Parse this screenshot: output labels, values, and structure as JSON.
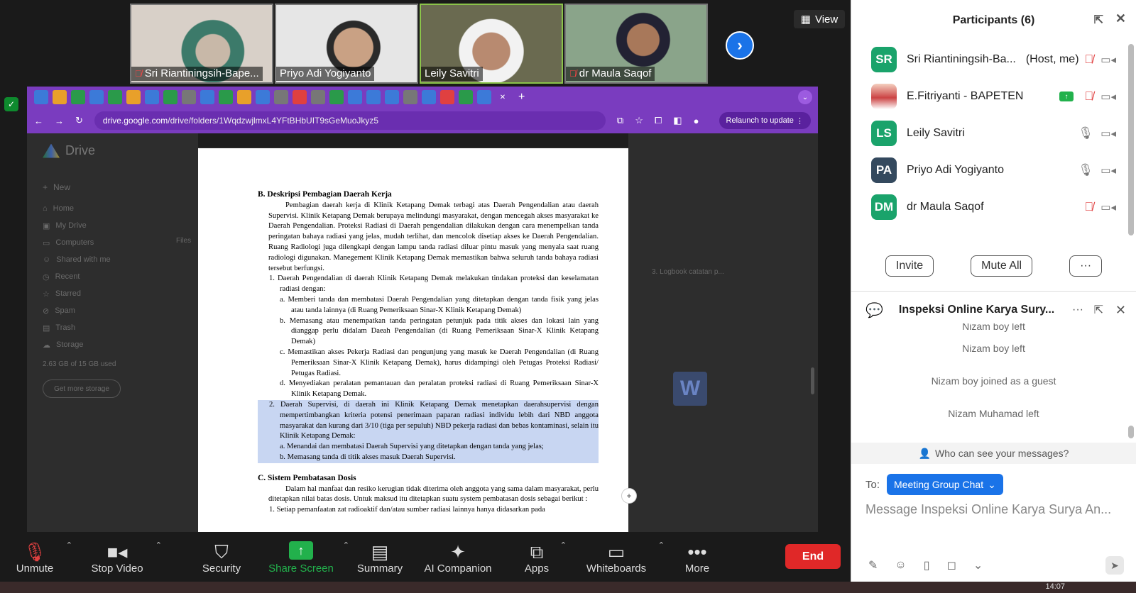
{
  "video_tiles": [
    {
      "name": "Sri Riantiningsih-Bape...",
      "muted": true
    },
    {
      "name": "Priyo Adi Yogiyanto",
      "muted": false
    },
    {
      "name": "Leily Savitri",
      "muted": false
    },
    {
      "name": "dr Maula Saqof",
      "muted": true
    }
  ],
  "view_label": "View",
  "browser": {
    "url_host": "drive.google.com",
    "url_path": "/drive/folders/1WqdzwjlmxL4YFtBHbUIT9sGeMuoJkyz5",
    "relaunch_label": "Relaunch to update"
  },
  "drive": {
    "logo_label": "Drive",
    "sidebar": [
      "Home",
      "My Drive",
      "Computers",
      "Shared with me",
      "Recent",
      "Starred",
      "Spam",
      "Trash",
      "Storage"
    ],
    "new_label": "New",
    "storage_text": "2.63 GB of 15 GB used",
    "get_more_label": "Get more storage",
    "doc_row": "3. Logbook catatan p...",
    "files_label": "Files"
  },
  "doc": {
    "heading_b": "B.  Deskripsi Pembagian Daerah Kerja",
    "para_b": "Pembagian daerah kerja di Klinik Ketapang Demak terbagi atas Daerah Pengendalian atau daerah Supervisi. Klinik Ketapang Demak berupaya melindungi masyarakat, dengan mencegah akses masyarakat ke Daerah Pengendalian. Proteksi Radiasi di Daerah pengendalian dilakukan dengan cara menempelkan tanda peringatan bahaya radiasi yang jelas, mudah terlihat, dan mencolok disetiap akses ke Daerah Pengendalian. Ruang Radiologi juga dilengkapi dengan lampu tanda radiasi diluar pintu masuk yang menyala saat ruang radiologi digunakan. Manegement Klinik Ketapang Demak memastikan bahwa seluruh tanda bahaya radiasi tersebut berfungsi.",
    "item1": "1.   Daerah Pengendalian di daerah Klinik Ketapang Demak melakukan tindakan proteksi dan keselamatan radiasi dengan:",
    "item1a": "a.   Memberi tanda dan membatasi Daerah Pengendalian yang ditetapkan dengan tanda fisik yang jelas atau tanda lainnya (di Ruang Pemeriksaan Sinar-X Klinik Ketapang Demak)",
    "item1b": "b.   Memasang atau menempatkan tanda peringatan petunjuk pada titik akses dan lokasi lain yang dianggap perlu didalam Daeah Pengendalian (di Ruang Pemeriksaan Sinar-X Klinik Ketapang Demak)",
    "item1c": "c.   Memastikan akses Pekerja Radiasi dan pengunjung yang masuk ke Daerah Pengendalian (di Ruang Pemeriksaan Sinar-X Klinik Ketapang Demak), harus didampingi oleh Petugas Proteksi Radiasi/ Petugas Radiasi.",
    "item1d": "d.   Menyediakan peralatan pemantauan dan peralatan proteksi radiasi di Ruang Pemeriksaan Sinar-X Klinik Ketapang Demak.",
    "item2": "2.   Daerah Supervisi, di daerah ini Klinik Ketapang Demak menetapkan daerahsupervisi dengan mempertimbangkan kriteria potensi penerimaan paparan radiasi individu lebih dari NBD anggota masyarakat dan kurang dari 3/10 (tiga per sepuluh) NBD pekerja radiasi dan bebas kontaminasi, selain itu Klinik Ketapang Demak:",
    "item2a": "a.   Menandai dan membatasi Daerah Supervisi yang ditetapkan dengan tanda yang jelas;",
    "item2b": "b.   Memasang tanda di titik akses masuk Daerah Supervisi.",
    "heading_c": "C. Sistem Pembatasan Dosis",
    "para_c": "Dalam hal manfaat dan resiko kerugian tidak diterima oleh anggota yang sama dalam masyarakat, perlu ditetapkan nilai batas dosis. Untuk maksud itu ditetapkan suatu system pembatasan dosis sebagai berikut :",
    "item_c1": "1.   Setiap pemanfaatan zat radioaktif dan/atau sumber radiasi lainnya hanya didasarkan pada"
  },
  "controls": [
    {
      "label": "Unmute",
      "icon": "mic-muted-icon",
      "caret": true
    },
    {
      "label": "Stop Video",
      "icon": "video-icon",
      "caret": true
    },
    {
      "label": "Security",
      "icon": "shield-icon",
      "caret": false
    },
    {
      "label": "Share Screen",
      "icon": "share-screen-icon",
      "caret": true
    },
    {
      "label": "Summary",
      "icon": "summary-icon",
      "caret": false
    },
    {
      "label": "AI Companion",
      "icon": "sparkle-icon",
      "caret": false
    },
    {
      "label": "Apps",
      "icon": "apps-icon",
      "caret": true
    },
    {
      "label": "Whiteboards",
      "icon": "whiteboard-icon",
      "caret": true
    },
    {
      "label": "More",
      "icon": "more-icon",
      "caret": false
    }
  ],
  "end_label": "End",
  "clock": "14:07",
  "participants_panel": {
    "title": "Participants (6)",
    "list": [
      {
        "initials": "SR",
        "name": "Sri Riantiningsih-Ba...",
        "role": "(Host, me)",
        "color": "#1aa36b",
        "mic": "muted"
      },
      {
        "initials": "",
        "name": "E.Fitriyanti - BAPETEN",
        "role": "",
        "color": "#c44",
        "mic": "muted",
        "sharing": true
      },
      {
        "initials": "LS",
        "name": "Leily Savitri",
        "role": "",
        "color": "#1aa36b",
        "mic": "on"
      },
      {
        "initials": "PA",
        "name": "Priyo Adi Yogiyanto",
        "role": "",
        "color": "#34495e",
        "mic": "on"
      },
      {
        "initials": "DM",
        "name": "dr Maula Saqof",
        "role": "",
        "color": "#1aa36b",
        "mic": "muted"
      }
    ],
    "invite_label": "Invite",
    "mute_all_label": "Mute All",
    "more_label": "···"
  },
  "chat": {
    "title": "Inspeksi Online Karya Sury...",
    "messages": [
      "Nizam boy left",
      "Nizam boy left",
      "Nizam boy joined as a guest",
      "Nizam Muhamad left"
    ],
    "who_can_see": "Who can see your messages?",
    "to_label": "To:",
    "recipient": "Meeting Group Chat",
    "placeholder": "Message Inspeksi Online Karya Surya An..."
  }
}
